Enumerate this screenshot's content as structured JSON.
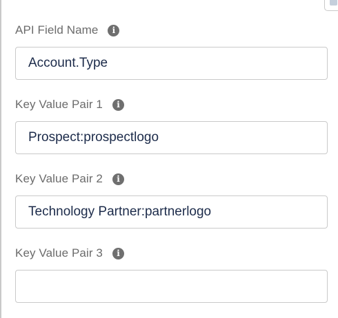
{
  "fields": [
    {
      "label": "API Field Name",
      "info_icon": "info-icon",
      "value": "Account.Type",
      "placeholder": ""
    },
    {
      "label": "Key Value Pair 1",
      "info_icon": "info-icon",
      "value": "Prospect:prospectlogo",
      "placeholder": ""
    },
    {
      "label": "Key Value Pair 2",
      "info_icon": "info-icon",
      "value": "Technology Partner:partnerlogo",
      "placeholder": ""
    },
    {
      "label": "Key Value Pair 3",
      "info_icon": "info-icon",
      "value": "",
      "placeholder": ""
    }
  ],
  "colors": {
    "label_text": "#6b6b6b",
    "input_text": "#1c2b4a",
    "input_border": "#c9c9c9",
    "info_icon_bg": "#6f6f6f"
  }
}
